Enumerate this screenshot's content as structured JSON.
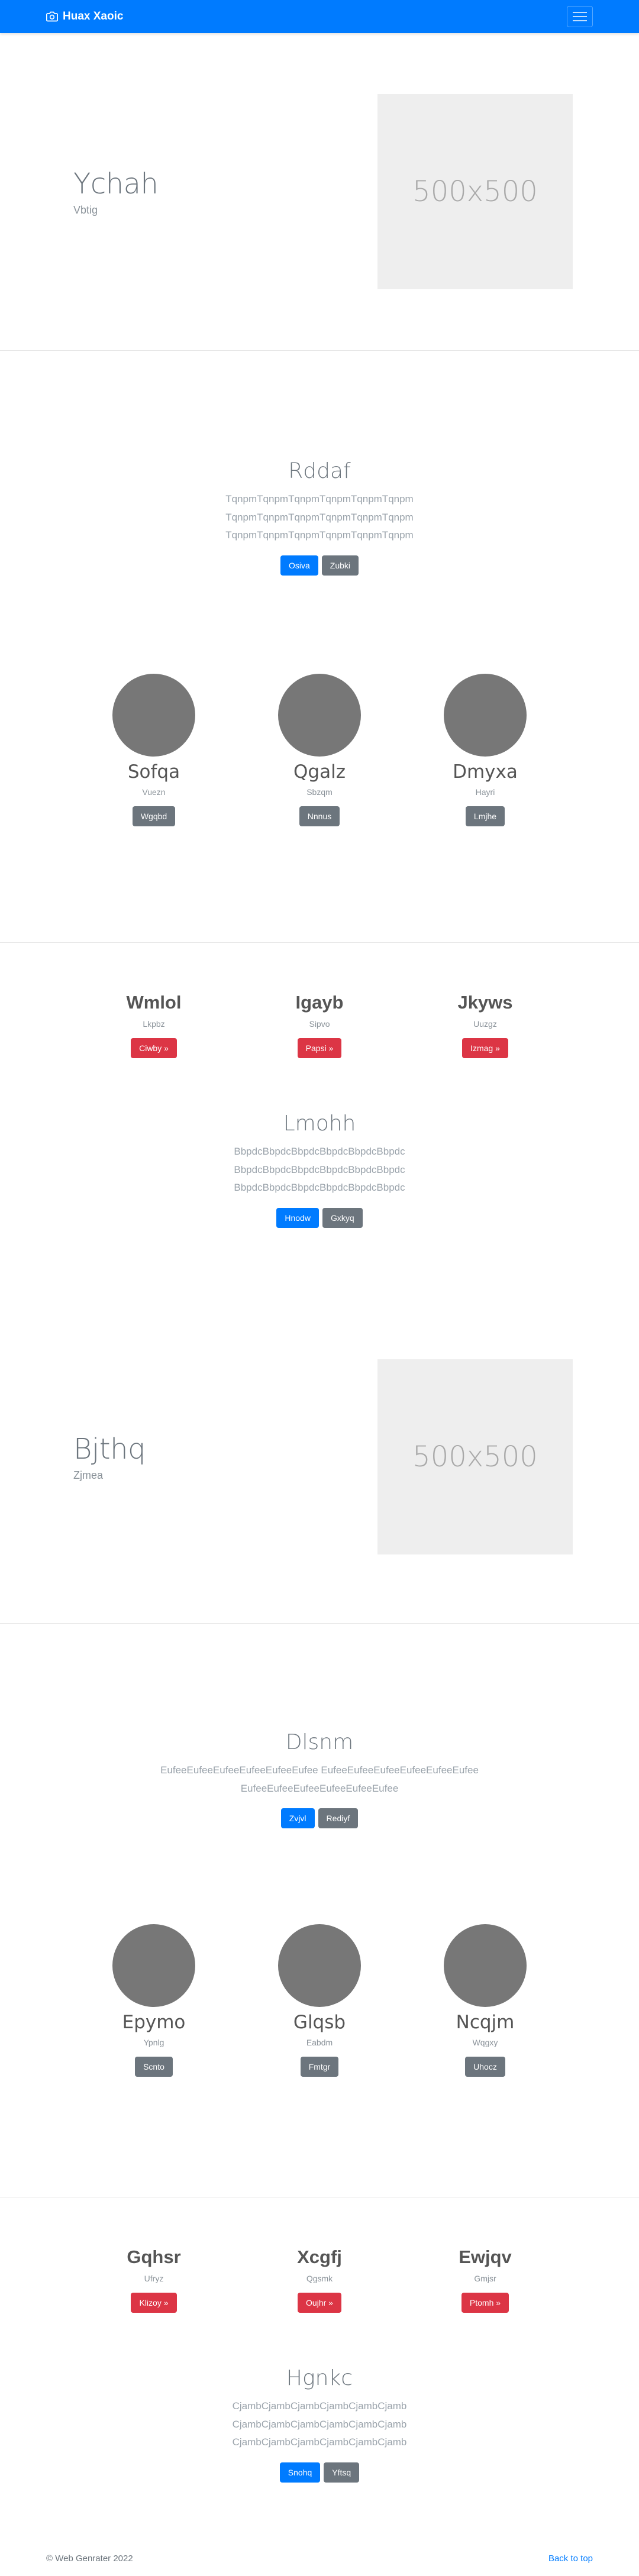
{
  "navbar": {
    "brand": "Huax Xaoic"
  },
  "hero1": {
    "title": "Ychah",
    "subtitle": "Vbtig",
    "placeholder": "500x500"
  },
  "block1": {
    "title": "Rddaf",
    "text": "TqnpmTqnpmTqnpmTqnpmTqnpmTqnpm TqnpmTqnpmTqnpmTqnpmTqnpmTqnpm TqnpmTqnpmTqnpmTqnpmTqnpmTqnpm",
    "btn_primary": "Osiva",
    "btn_secondary": "Zubki"
  },
  "profiles1": [
    {
      "name": "Sofqa",
      "sub": "Vuezn",
      "btn": "Wgqbd"
    },
    {
      "name": "Qgalz",
      "sub": "Sbzqm",
      "btn": "Nnnus"
    },
    {
      "name": "Dmyxa",
      "sub": "Hayri",
      "btn": "Lmjhe"
    }
  ],
  "features1": [
    {
      "title": "Wmlol",
      "sub": "Lkpbz",
      "btn": "Ciwby »"
    },
    {
      "title": "Igayb",
      "sub": "Sipvo",
      "btn": "Papsi »"
    },
    {
      "title": "Jkyws",
      "sub": "Uuzgz",
      "btn": "Izmag »"
    }
  ],
  "block2": {
    "title": "Lmohh",
    "text": "BbpdcBbpdcBbpdcBbpdcBbpdcBbpdc BbpdcBbpdcBbpdcBbpdcBbpdcBbpdc BbpdcBbpdcBbpdcBbpdcBbpdcBbpdc",
    "btn_primary": "Hnodw",
    "btn_secondary": "Gxkyq"
  },
  "hero2": {
    "title": "Bjthq",
    "subtitle": "Zjmea",
    "placeholder": "500x500"
  },
  "block3": {
    "title": "Dlsnm",
    "text": "EufeeEufeeEufeeEufeeEufeeEufee EufeeEufeeEufeeEufeeEufeeEufee EufeeEufeeEufeeEufeeEufeeEufee",
    "btn_primary": "Zvjvl",
    "btn_secondary": "Rediyf"
  },
  "profiles2": [
    {
      "name": "Epymo",
      "sub": "Ypnlg",
      "btn": "Scnto"
    },
    {
      "name": "Glqsb",
      "sub": "Eabdm",
      "btn": "Fmtgr"
    },
    {
      "name": "Ncqjm",
      "sub": "Wqgxy",
      "btn": "Uhocz"
    }
  ],
  "features2": [
    {
      "title": "Gqhsr",
      "sub": "Ufryz",
      "btn": "Klizoy »"
    },
    {
      "title": "Xcgfj",
      "sub": "Qgsmk",
      "btn": "Oujhr »"
    },
    {
      "title": "Ewjqv",
      "sub": "Gmjsr",
      "btn": "Ptomh »"
    }
  ],
  "block4": {
    "title": "Hgnkc",
    "text": "CjambCjambCjambCjambCjambCjamb CjambCjambCjambCjambCjambCjamb CjambCjambCjambCjambCjambCjamb",
    "btn_primary": "Snohq",
    "btn_secondary": "Yftsq"
  },
  "footer": {
    "copyright": "© Web Genrater 2022",
    "back_to_top": "Back to top"
  }
}
